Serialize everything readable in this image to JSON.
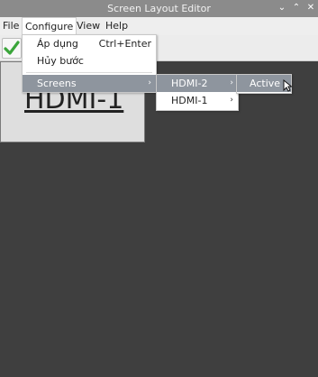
{
  "window": {
    "title": "Screen Layout Editor"
  },
  "menubar": {
    "file": "File",
    "configure": "Configure",
    "view": "View",
    "help": "Help"
  },
  "configure_menu": {
    "apply": "Áp dụng",
    "apply_shortcut": "Ctrl+Enter",
    "undo": "Hủy bước",
    "screens": "Screens"
  },
  "screens_menu": {
    "hdmi2": "HDMI-2",
    "hdmi1": "HDMI-1"
  },
  "hdmi2_menu": {
    "active": "Active"
  },
  "canvas": {
    "monitor_label": "HDMI-1"
  },
  "colors": {
    "highlight": "#8e959e",
    "titlebar": "#8b8b8b",
    "canvas": "#3f3f3f",
    "apply_check": "#3aa53a"
  },
  "icons": {
    "apply": "check-icon",
    "minimize": "chevron-down-icon",
    "maximize": "chevron-up-icon",
    "close": "close-icon",
    "submenu": "chevron-right-icon"
  }
}
